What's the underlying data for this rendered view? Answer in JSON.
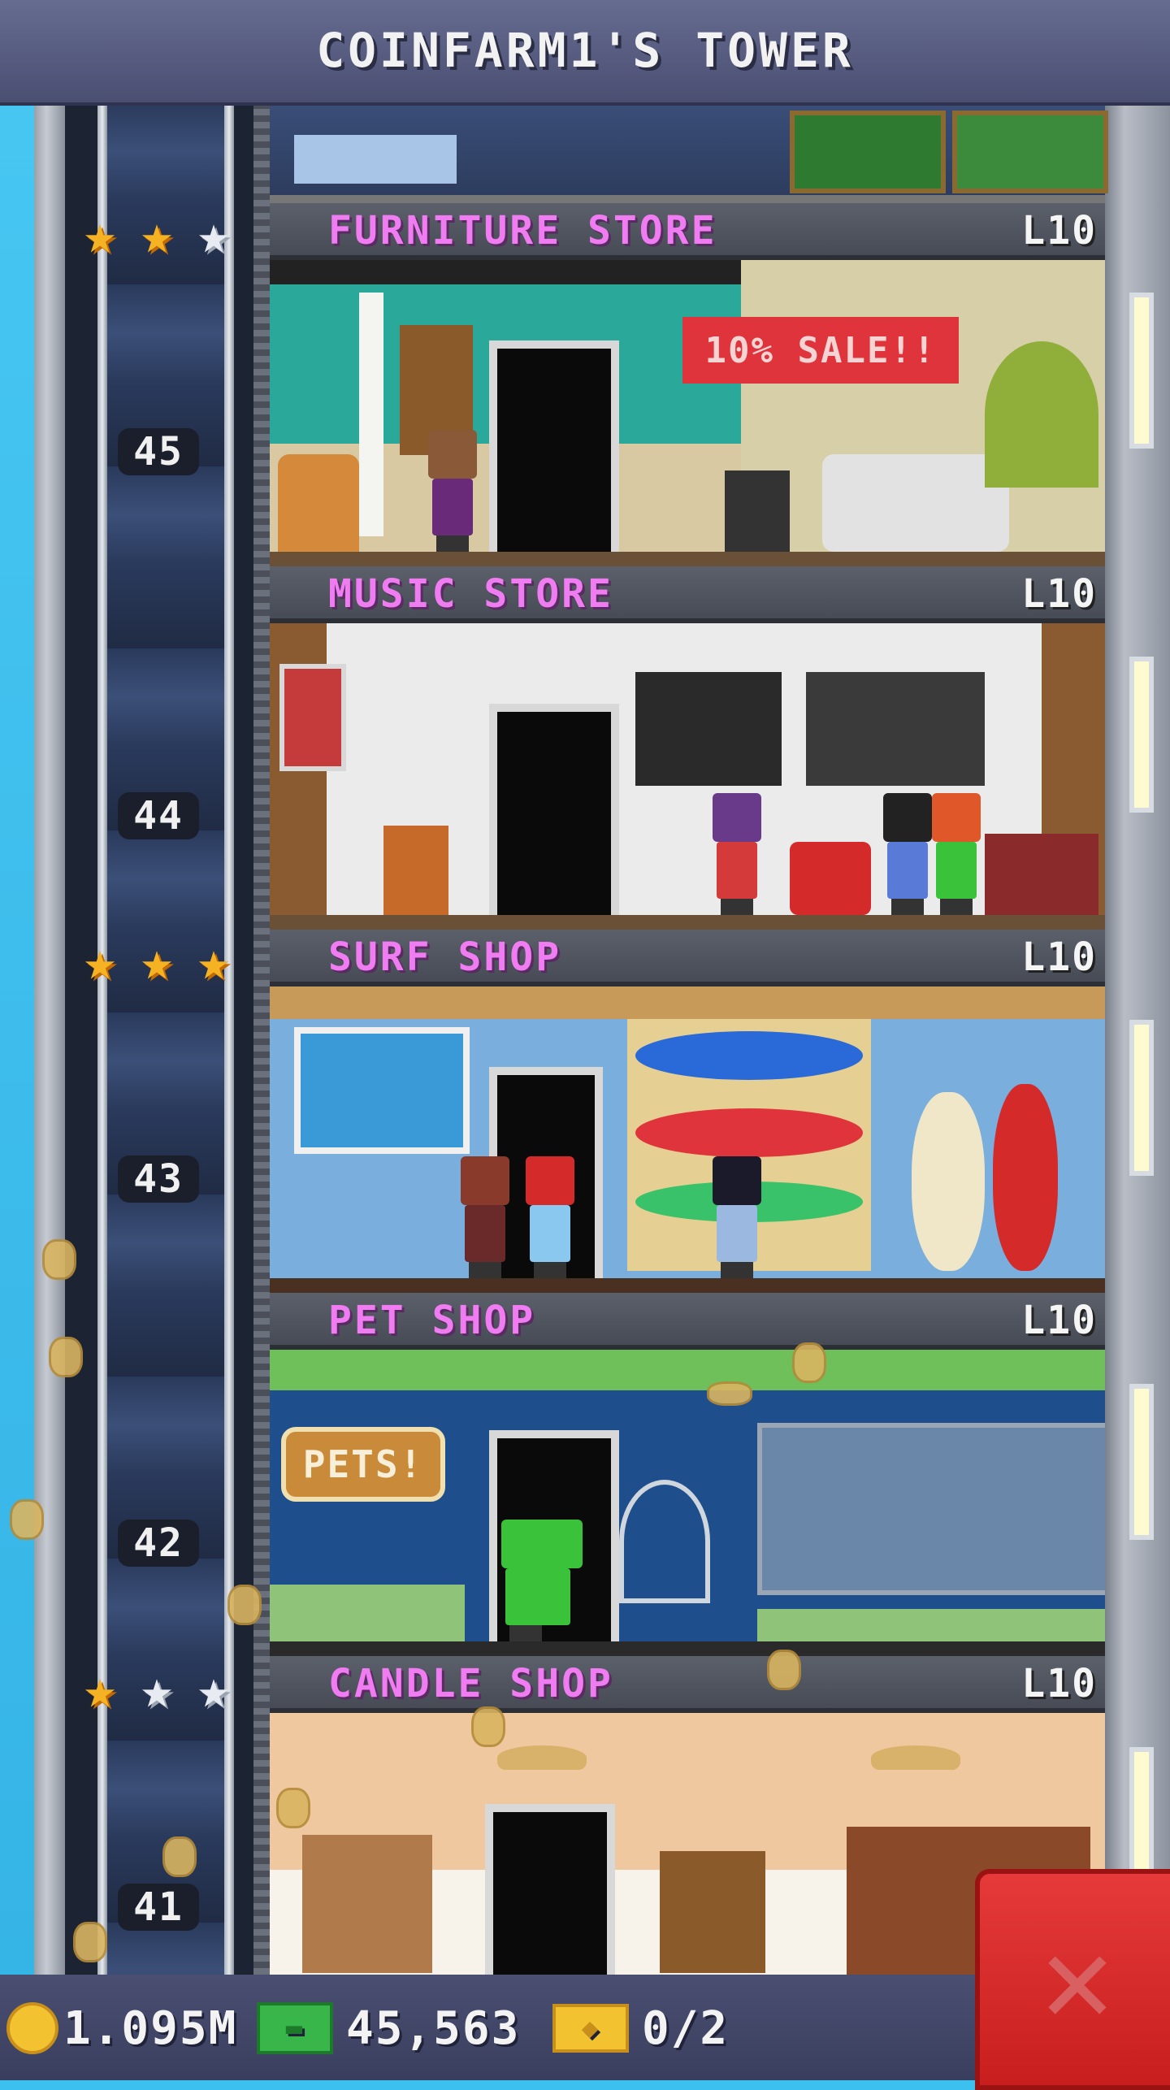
{
  "header": {
    "title": "COINFARM1'S TOWER"
  },
  "floors": [
    {
      "name": "FURNITURE STORE",
      "level": "L10",
      "number": "45",
      "stars": [
        "gold",
        "gold",
        "silver"
      ],
      "sign": "10% SALE!!"
    },
    {
      "name": "MUSIC STORE",
      "level": "L10",
      "number": "44",
      "stars": []
    },
    {
      "name": "SURF SHOP",
      "level": "L10",
      "number": "43",
      "stars": [
        "gold",
        "gold",
        "gold"
      ]
    },
    {
      "name": "PET SHOP",
      "level": "L10",
      "number": "42",
      "stars": [],
      "sign": "PETS!"
    },
    {
      "name": "CANDLE SHOP",
      "level": "L10",
      "number": "41",
      "stars": [
        "gold",
        "silver",
        "silver"
      ]
    }
  ],
  "footer": {
    "coins": "1.095M",
    "bux": "45,563",
    "tickets": "0/2"
  },
  "icons": {
    "coin": "coin-icon",
    "bux": "bux-icon",
    "ticket": "ticket-icon",
    "close": "close-icon",
    "star": "star-icon"
  },
  "colors": {
    "floor_name": "#f07cf2",
    "gold_star": "#f5b324",
    "silver_star": "#e8ecf2",
    "close_button": "#e63a3a"
  }
}
